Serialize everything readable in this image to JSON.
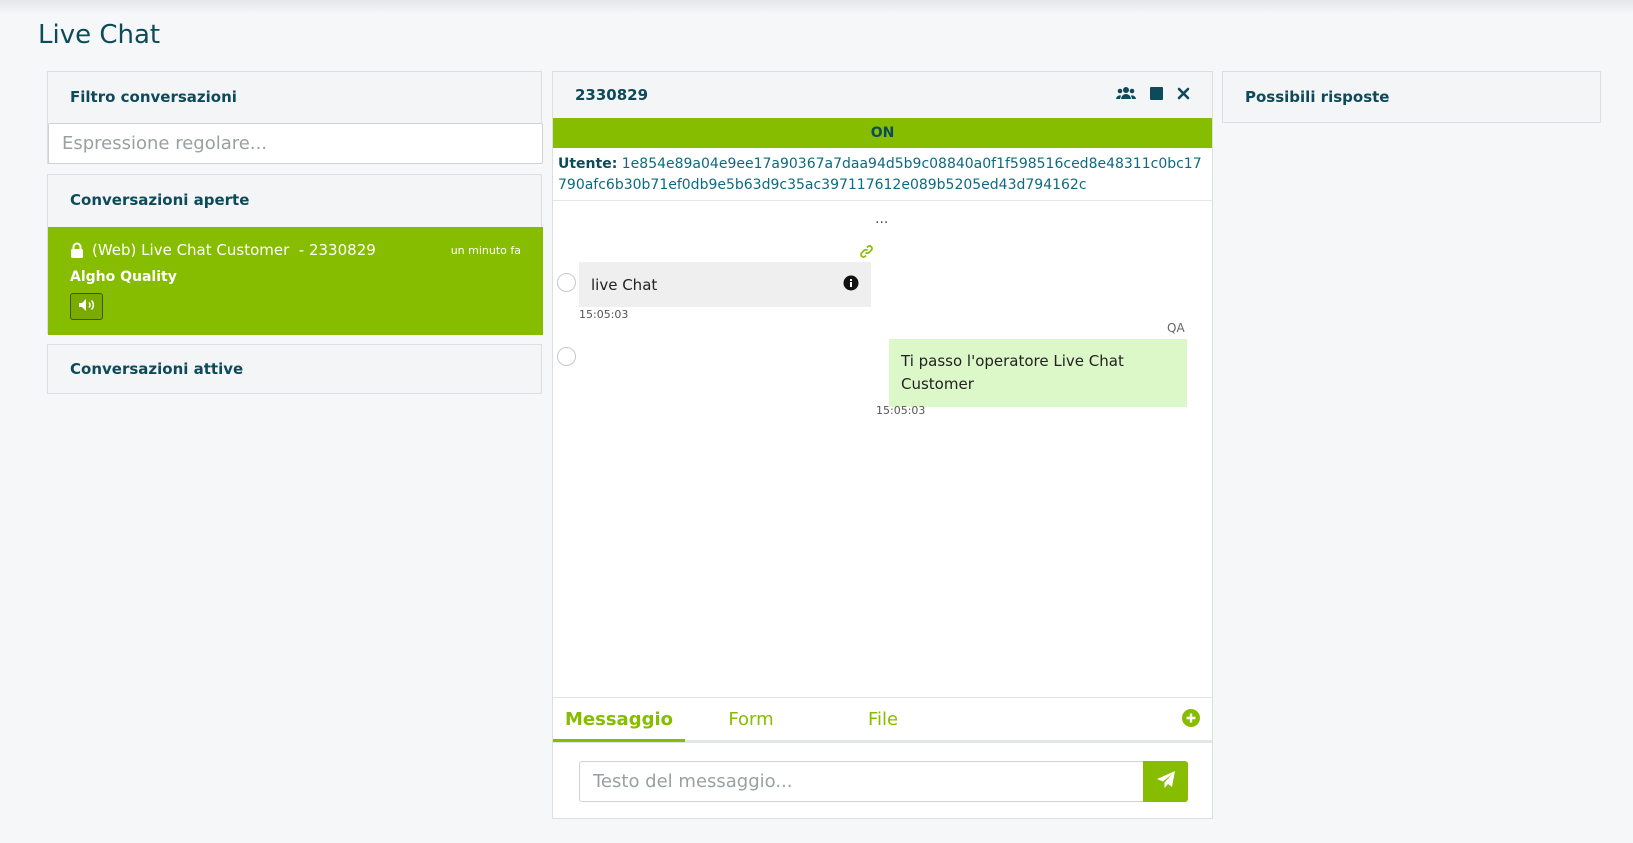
{
  "page": {
    "title": "Live Chat"
  },
  "filter": {
    "heading": "Filtro conversazioni",
    "placeholder": "Espressione regolare..."
  },
  "open_conversations": {
    "heading": "Conversazioni aperte",
    "items": [
      {
        "label": "(Web) Live Chat Customer  - 2330829",
        "time": "un minuto fa",
        "organization": "Algho Quality",
        "icons": [
          "lock-icon",
          "volume-icon"
        ]
      }
    ]
  },
  "active_conversations": {
    "heading": "Conversazioni attive"
  },
  "chat": {
    "id": "2330829",
    "header_icons": [
      "users-icon",
      "stop-icon",
      "close-icon"
    ],
    "status": "ON",
    "user_label": "Utente:",
    "user_id": "1e854e89a04e9ee17a90367a7daa94d5b9c08840a0f1f598516ced8e48311c0bc17790afc6b30b71ef0db9e5b63d9c35ac397117612e089b5205ed43d794162c",
    "loading_dots": "...",
    "messages": [
      {
        "direction": "in",
        "text": "live Chat",
        "time": "15:05:03"
      },
      {
        "direction": "out",
        "sender": "QA",
        "text": "Ti passo l'operatore Live Chat Customer",
        "time": "15:05:03"
      }
    ],
    "tabs": [
      {
        "label": "Messaggio",
        "active": true
      },
      {
        "label": "Form",
        "active": false
      },
      {
        "label": "File",
        "active": false
      }
    ],
    "compose_placeholder": "Testo del messaggio..."
  },
  "answers": {
    "heading": "Possibili risposte"
  },
  "colors": {
    "accent": "#86bd00",
    "title": "#0d4a5a",
    "bubble_out": "#dcf7c8",
    "bubble_in": "#efefef"
  }
}
